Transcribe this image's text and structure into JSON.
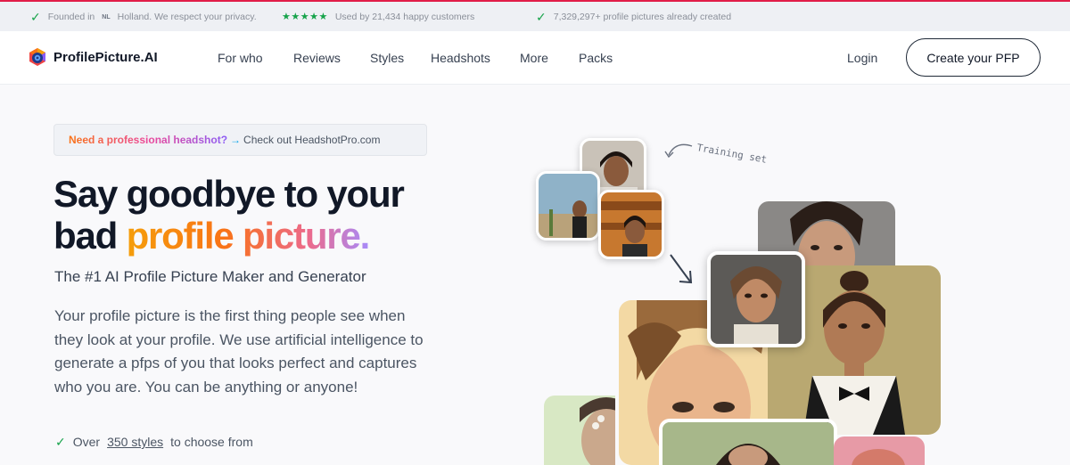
{
  "topbar": {
    "item1": {
      "prefix": "Founded in",
      "country": "NL",
      "suffix": "Holland. We respect your privacy."
    },
    "item2": {
      "stars": "★★★★★",
      "text": "Used by 21,434 happy customers"
    },
    "item3": {
      "text": "7,329,297+ profile pictures already created"
    }
  },
  "brand": {
    "name": "ProfilePicture.AI"
  },
  "nav": {
    "links": [
      "For who",
      "Reviews",
      "Styles",
      "Headshots",
      "More",
      "Packs"
    ],
    "login": "Login",
    "cta": "Create your PFP"
  },
  "promo": {
    "highlight": "Need a professional headshot?",
    "arrow": "→",
    "text": "Check out HeadshotPro.com"
  },
  "hero": {
    "line1": "Say goodbye to your",
    "line2_plain": "bad",
    "line2_accent": "profile picture.",
    "subtitle": "The #1 AI Profile Picture Maker and Generator",
    "paragraph": "Your profile picture is the first thing people see when they look at your profile. We use artificial intelligence to generate a pfps of you that looks perfect and captures who you are. You can be anything or anyone!",
    "bullet_prefix": "Over",
    "bullet_link": "350 styles",
    "bullet_suffix": "to choose from"
  },
  "visual": {
    "annotation": "Training set"
  },
  "colors": {
    "accent_green": "#16a34a",
    "promo_gradient": [
      "#f97316",
      "#ec4899",
      "#8b5cf6"
    ],
    "top_rule": "#e11d48"
  }
}
